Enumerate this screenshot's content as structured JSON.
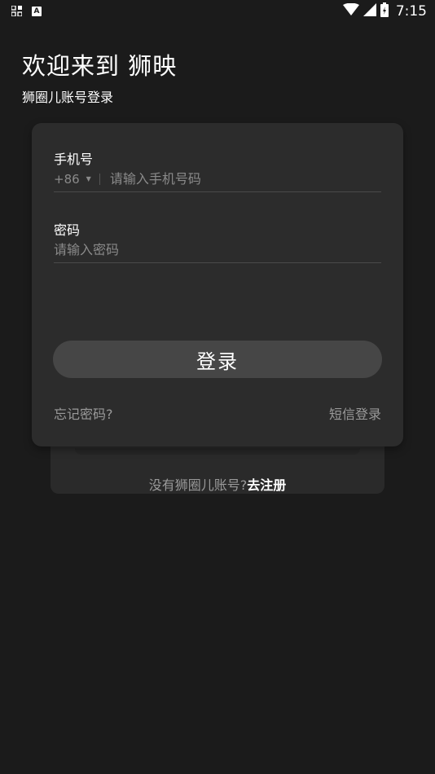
{
  "status_bar": {
    "time": "7:15",
    "notification_icons": [
      "grid-app-icon",
      "a-app-icon"
    ],
    "system_icons": [
      "wifi-icon",
      "signal-icon",
      "battery-icon"
    ]
  },
  "header": {
    "title": "欢迎来到 狮映",
    "subtitle": "狮圈儿账号登录"
  },
  "form": {
    "phone_label": "手机号",
    "country_code": "+86",
    "phone_placeholder": "请输入手机号码",
    "phone_value": "",
    "password_label": "密码",
    "password_placeholder": "请输入密码",
    "password_value": "",
    "login_button": "登录",
    "forgot_password": "忘记密码?",
    "sms_login": "短信登录"
  },
  "register": {
    "prompt": "没有狮圈儿账号?",
    "link": "去注册"
  },
  "colors": {
    "background": "#1b1b1b",
    "card": "#2c2c2c",
    "button": "#464646",
    "muted_text": "#8a8a8a"
  }
}
